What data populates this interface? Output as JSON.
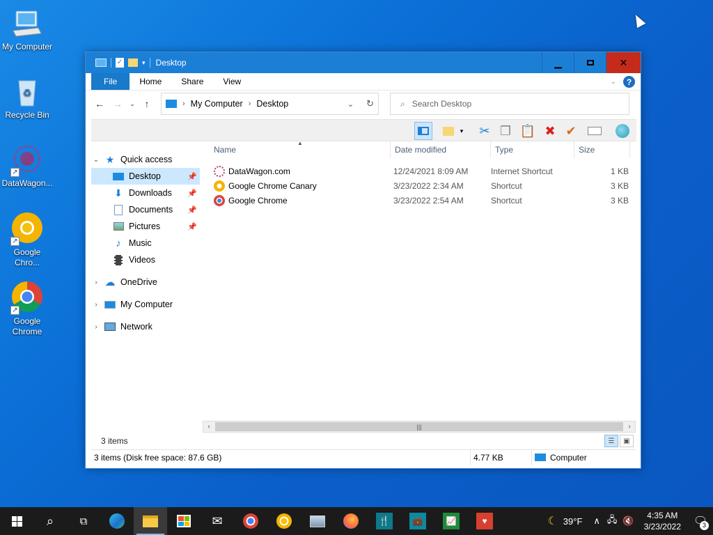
{
  "desktop": {
    "icons": [
      {
        "label": "My Computer"
      },
      {
        "label": "Recycle Bin"
      },
      {
        "label": "DataWagon..."
      },
      {
        "label": "Google Chro..."
      },
      {
        "label": "Google Chrome"
      }
    ]
  },
  "window": {
    "title": "Desktop",
    "ribbon_tabs": [
      "File",
      "Home",
      "Share",
      "View"
    ],
    "address": {
      "root": "My Computer",
      "current": "Desktop"
    },
    "search_placeholder": "Search Desktop",
    "nav": {
      "quick_access": "Quick access",
      "quick_items": [
        "Desktop",
        "Downloads",
        "Documents",
        "Pictures",
        "Music",
        "Videos"
      ],
      "onedrive": "OneDrive",
      "my_computer": "My Computer",
      "network": "Network"
    },
    "columns": [
      "Name",
      "Date modified",
      "Type",
      "Size"
    ],
    "files": [
      {
        "name": "DataWagon.com",
        "date": "12/24/2021 8:09 AM",
        "type": "Internet Shortcut",
        "size": "1 KB"
      },
      {
        "name": "Google Chrome Canary",
        "date": "3/23/2022 2:34 AM",
        "type": "Shortcut",
        "size": "3 KB"
      },
      {
        "name": "Google Chrome",
        "date": "3/23/2022 2:54 AM",
        "type": "Shortcut",
        "size": "3 KB"
      }
    ],
    "status_count": "3 items",
    "details": {
      "summary": "3 items (Disk free space: 87.6 GB)",
      "size": "4.77 KB",
      "location": "Computer"
    }
  },
  "taskbar": {
    "weather": "39°F",
    "time": "4:35 AM",
    "date": "3/23/2022",
    "notifications": "3"
  },
  "colors": {
    "accent": "#1c7fd6",
    "close": "#c42b1c",
    "selection": "#cce8ff"
  }
}
